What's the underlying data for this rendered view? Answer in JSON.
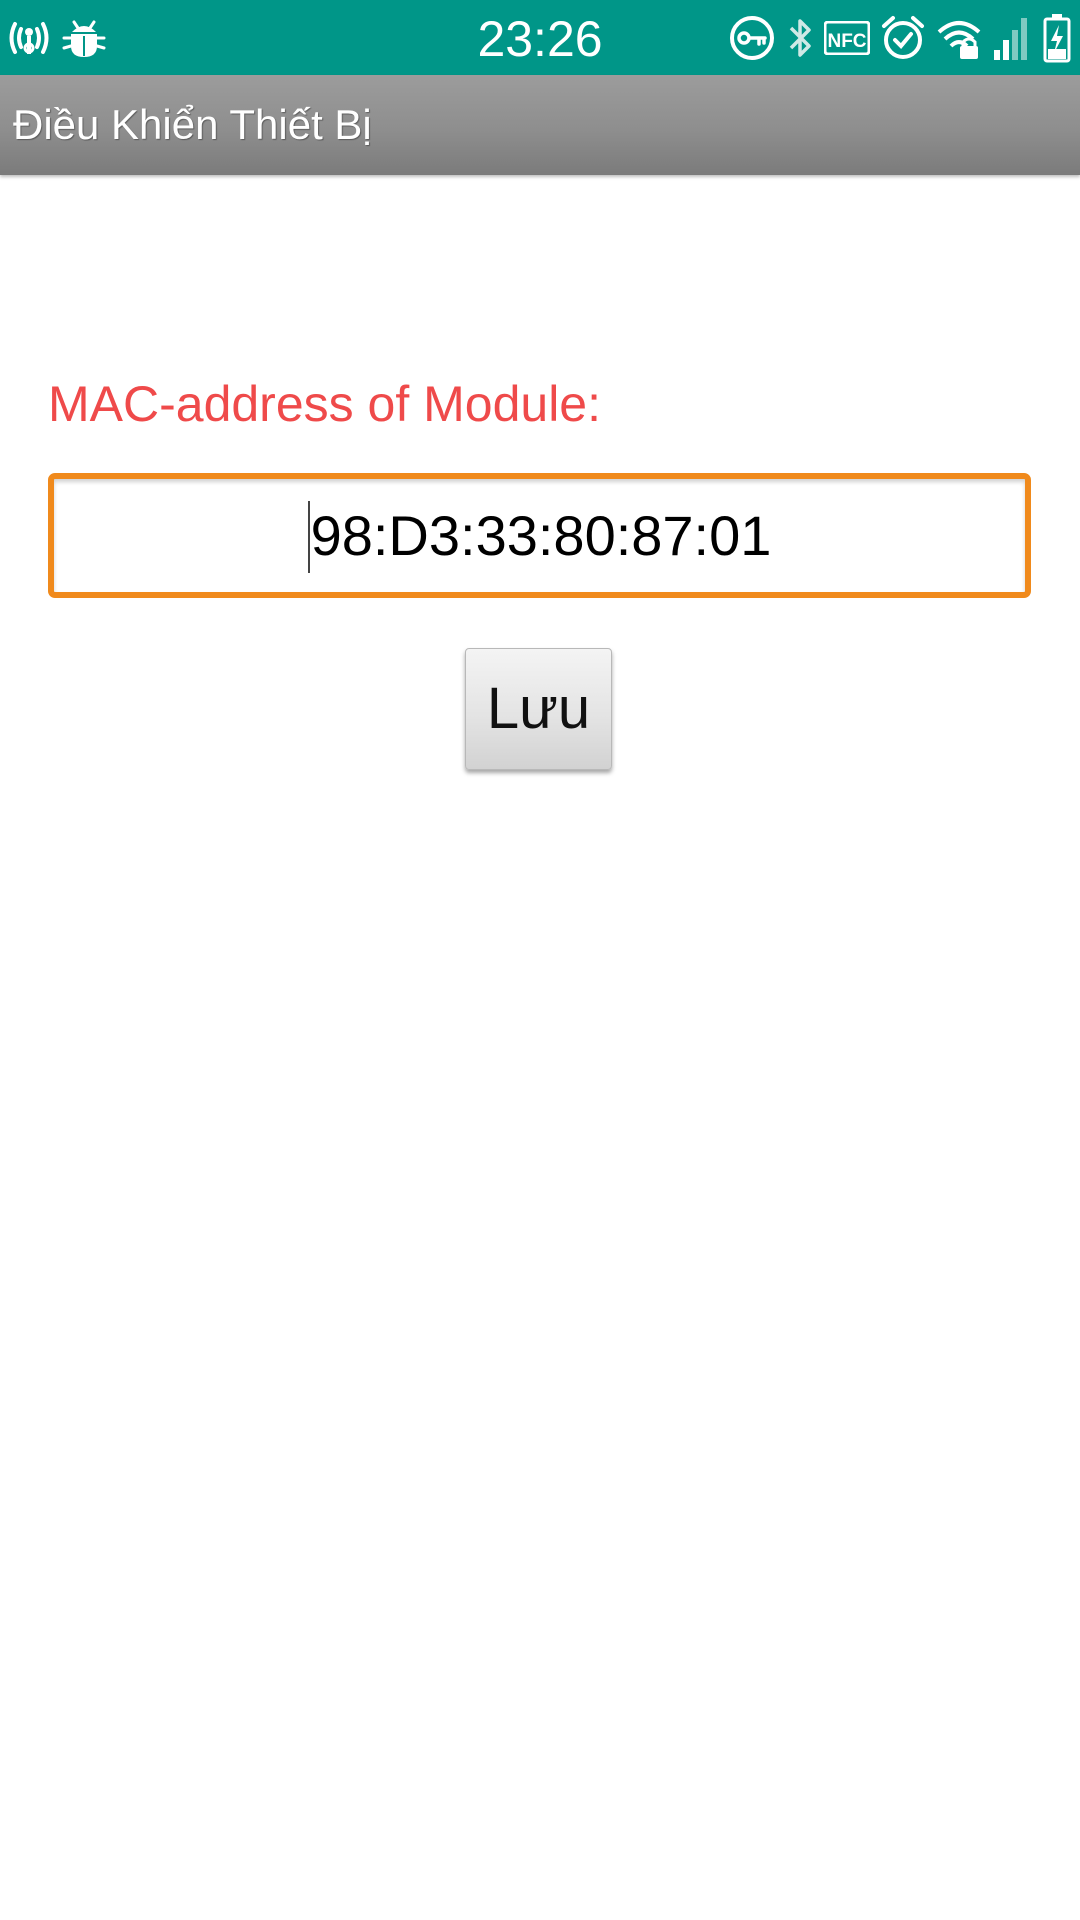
{
  "status_bar": {
    "time": "23:26",
    "left_icons": [
      "wireless-debug-icon",
      "bug-icon"
    ],
    "right_icons": [
      "vpn-key-icon",
      "bluetooth-icon",
      "nfc-icon",
      "alarm-icon",
      "wifi-icon",
      "signal-icon",
      "battery-charging-icon"
    ],
    "nfc_text": "NFC",
    "background": "#009688"
  },
  "app_bar": {
    "title": "Điều Khiển Thiết Bị"
  },
  "form": {
    "label": "MAC-address of Module:",
    "label_color": "#ef4a4a",
    "mac_value": "98:D3:33:80:87:01",
    "field_border_color": "#f08a1c",
    "save_label": "Lưu"
  }
}
